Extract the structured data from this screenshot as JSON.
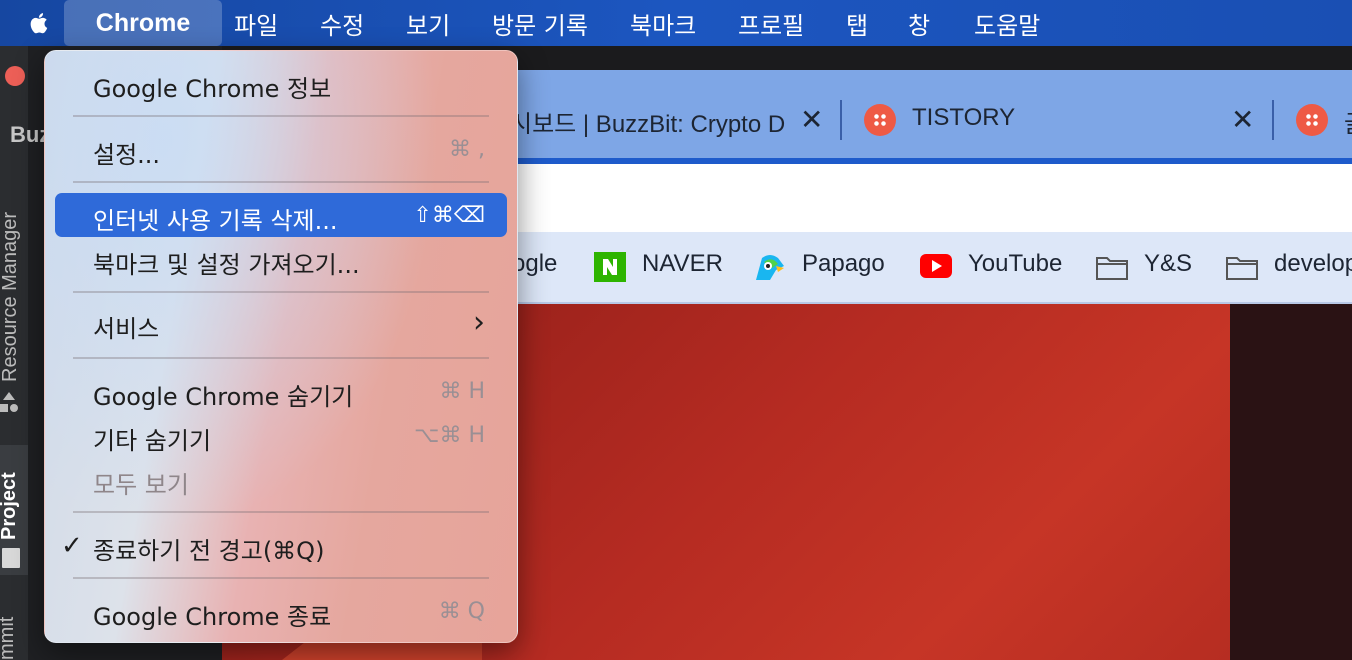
{
  "menubar": {
    "apple_icon": "apple-logo-icon",
    "app_name": "Chrome",
    "items": [
      "파일",
      "수정",
      "보기",
      "방문 기록",
      "북마크",
      "프로필",
      "탭",
      "창",
      "도움말"
    ]
  },
  "ide": {
    "title": "Buz",
    "side_tabs": [
      "Resource Manager",
      "Project",
      "mmit"
    ]
  },
  "browser": {
    "tabs": [
      {
        "title": "시보드 | BuzzBit: Crypto D",
        "close": "✕"
      },
      {
        "title": "TISTORY",
        "close": "✕"
      },
      {
        "title": "글",
        "close": ""
      }
    ],
    "bookmarks": [
      "ogle",
      "NAVER",
      "Papago",
      "YouTube",
      "Y&S",
      "develop"
    ]
  },
  "chrome_menu": {
    "about": "Google Chrome 정보",
    "settings": "설정...",
    "settings_shortcut": "⌘ ,",
    "clear_history": "인터넷 사용 기록 삭제...",
    "clear_history_shortcut": "⇧⌘⌫",
    "import": "북마크 및 설정 가져오기...",
    "services": "서비스",
    "services_arrow": "›",
    "hide": "Google Chrome 숨기기",
    "hide_shortcut": "⌘ H",
    "hide_others": "기타 숨기기",
    "hide_others_shortcut": "⌥⌘ H",
    "show_all": "모두 보기",
    "warn_before_quit": "종료하기 전 경고(⌘Q)",
    "warn_check": "✓",
    "quit": "Google Chrome 종료",
    "quit_shortcut": "⌘ Q"
  },
  "colors": {
    "menubar": "#1c56c0",
    "highlight": "#2f6ad9",
    "tabbar": "#7ea6e6",
    "tistory": "#ee5a45"
  }
}
